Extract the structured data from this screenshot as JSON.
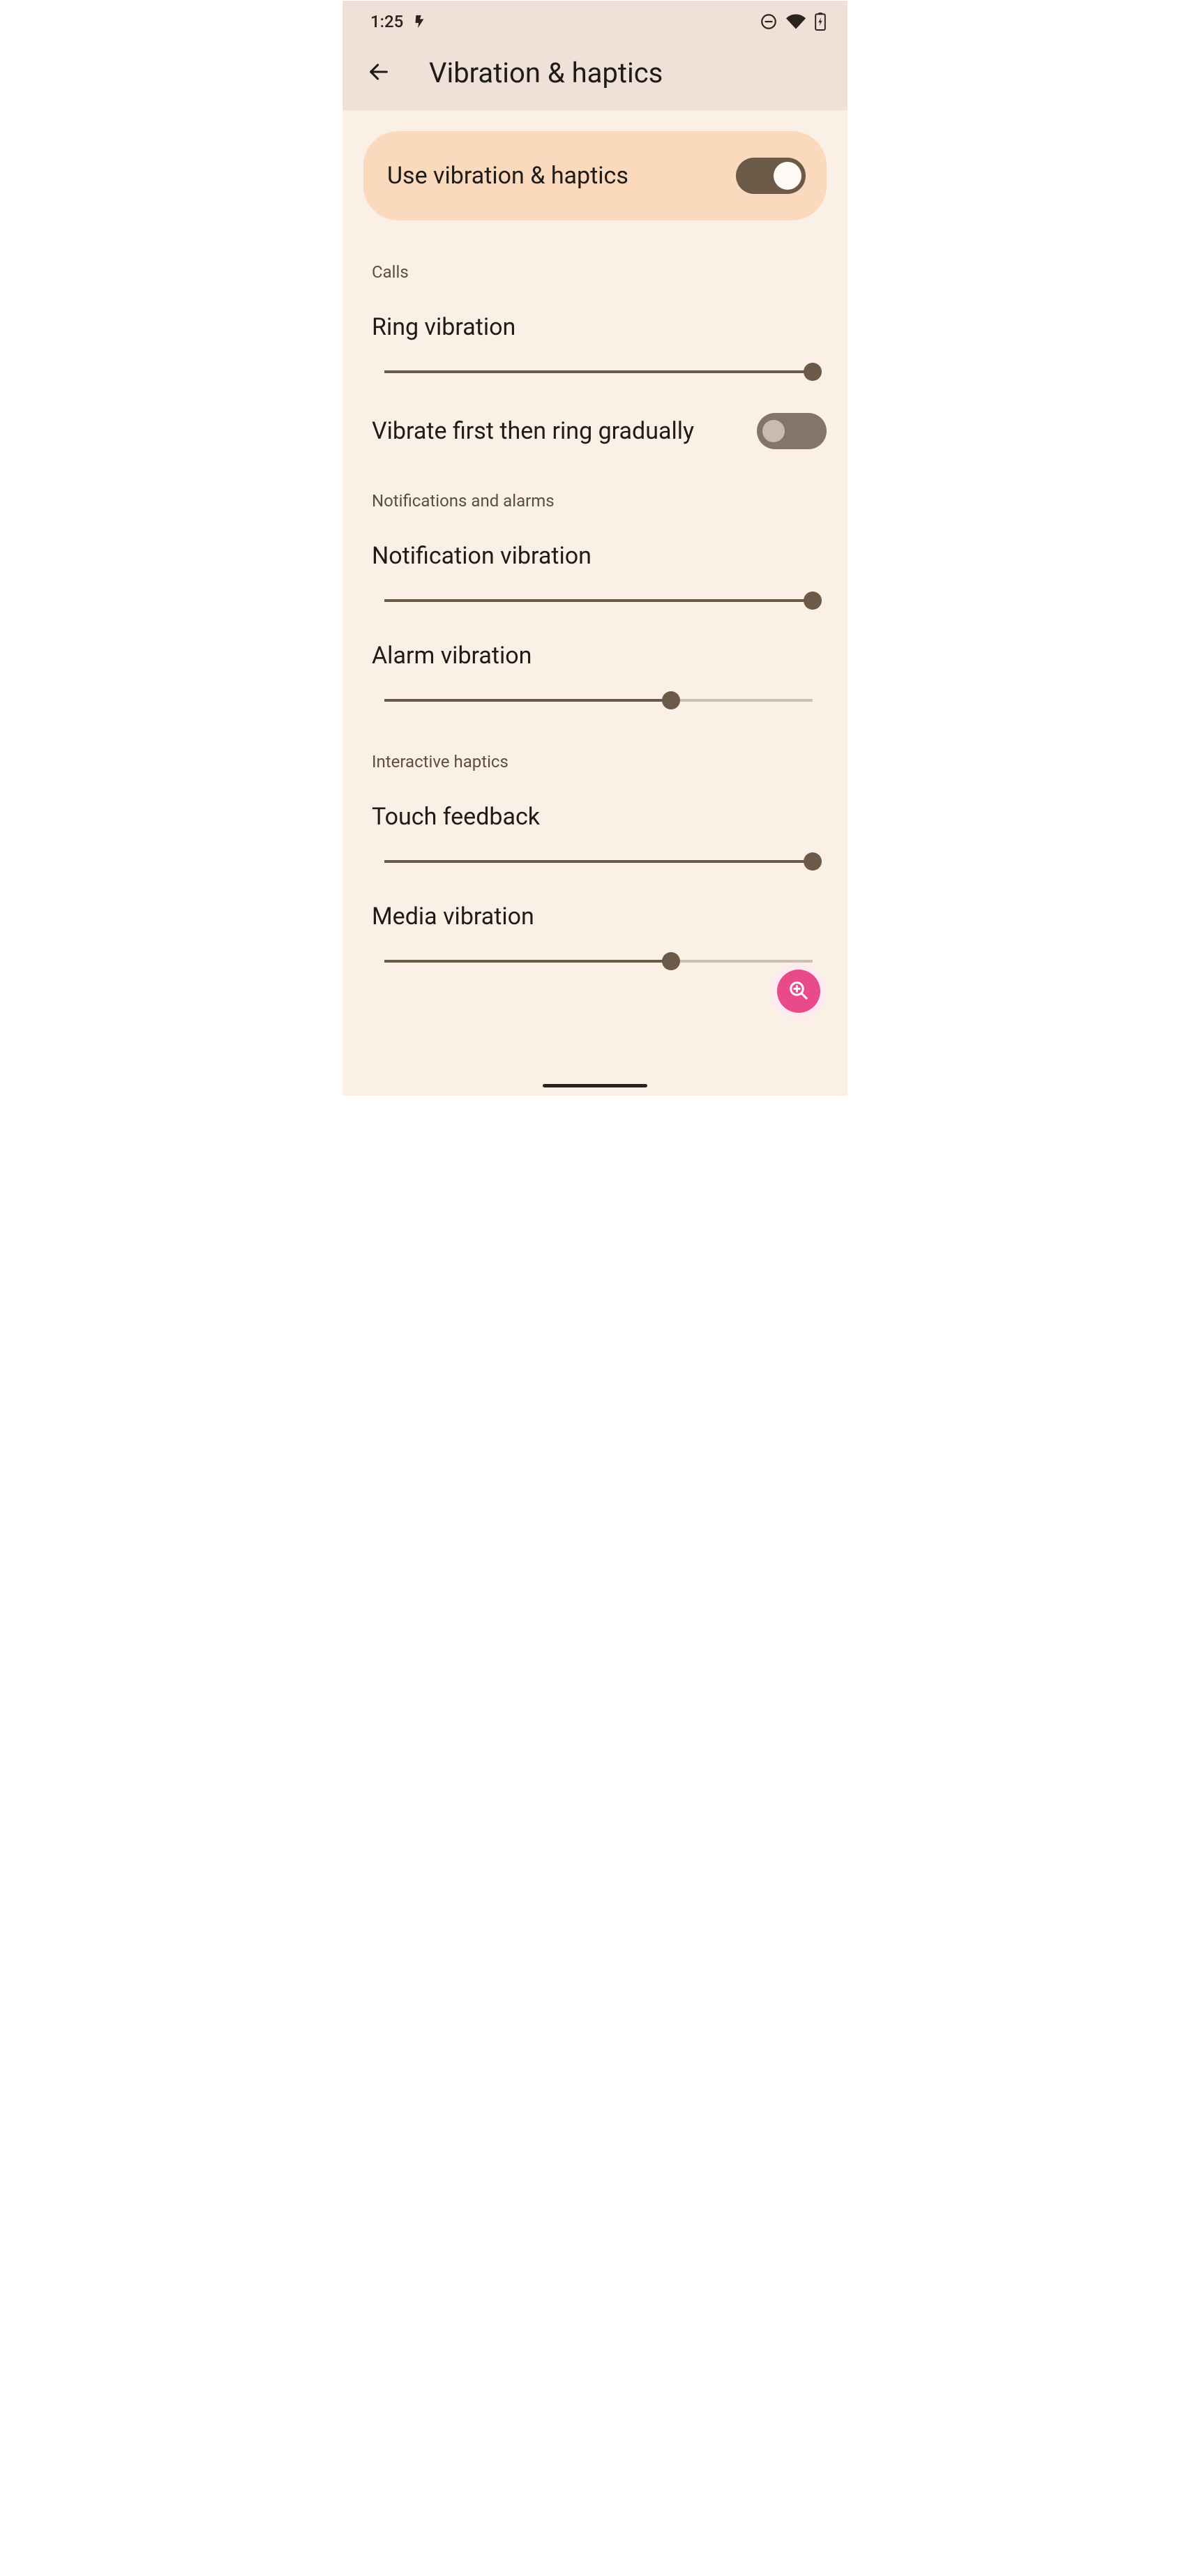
{
  "status": {
    "time": "1:25"
  },
  "header": {
    "title": "Vibration & haptics"
  },
  "master": {
    "label": "Use vibration & haptics",
    "enabled": true
  },
  "sections": {
    "calls": {
      "header": "Calls",
      "ring": {
        "label": "Ring vibration",
        "value": 100
      },
      "gradual": {
        "label": "Vibrate first then ring gradually",
        "enabled": false
      }
    },
    "notifications": {
      "header": "Notifications and alarms",
      "notification": {
        "label": "Notification vibration",
        "value": 100
      },
      "alarm": {
        "label": "Alarm vibration",
        "value": 67
      }
    },
    "interactive": {
      "header": "Interactive haptics",
      "touch": {
        "label": "Touch feedback",
        "value": 100
      },
      "media": {
        "label": "Media vibration",
        "value": 67
      }
    }
  }
}
